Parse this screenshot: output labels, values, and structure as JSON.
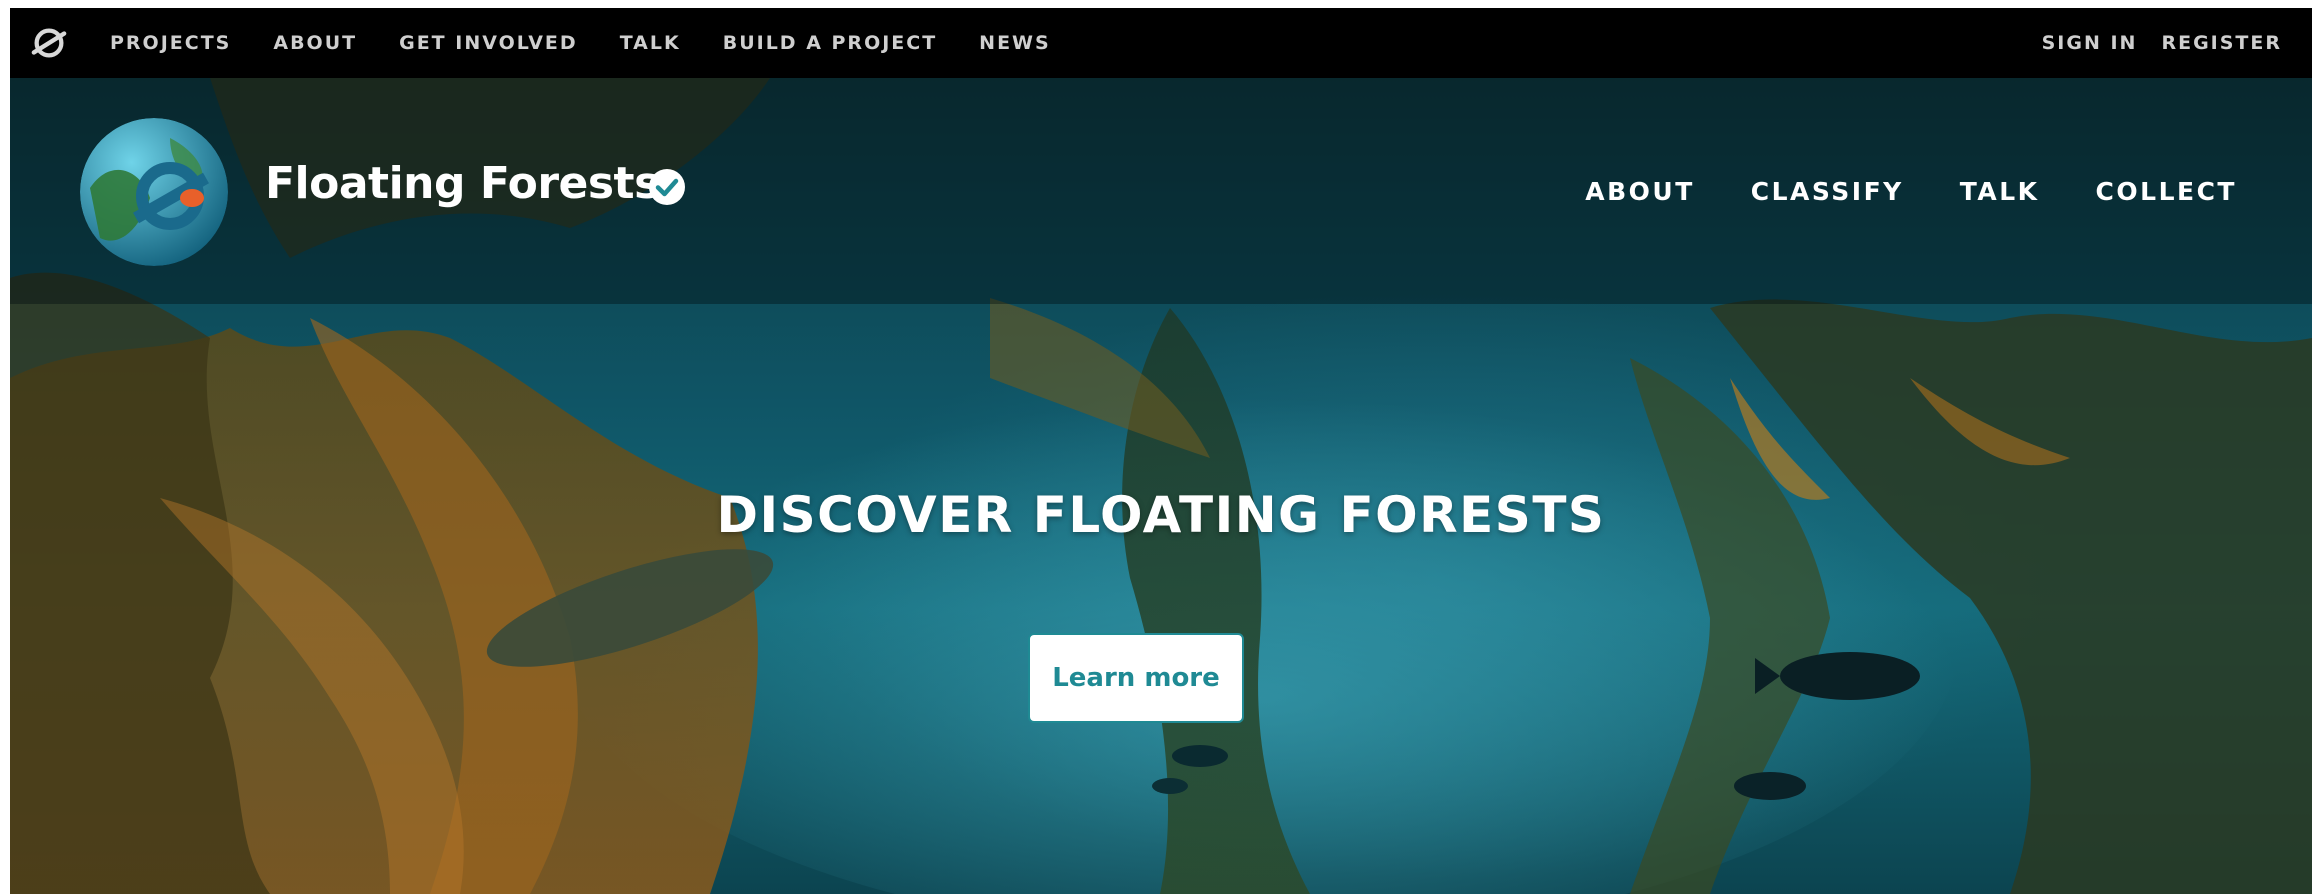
{
  "top_nav": {
    "logo_icon": "zooniverse-logo-icon",
    "links": [
      "PROJECTS",
      "ABOUT",
      "GET INVOLVED",
      "TALK",
      "BUILD A PROJECT",
      "NEWS"
    ],
    "sign_in": "SIGN IN",
    "register": "REGISTER"
  },
  "project": {
    "title": "Floating Forests",
    "verified_icon": "verified-check-icon",
    "nav": [
      "ABOUT",
      "CLASSIFY",
      "TALK",
      "COLLECT"
    ]
  },
  "hero": {
    "heading": "DISCOVER FLOATING FORESTS",
    "button_label": "Learn more"
  },
  "colors": {
    "top_bar": "#000000",
    "accent": "#1f8a94",
    "water": "#146a7a"
  }
}
